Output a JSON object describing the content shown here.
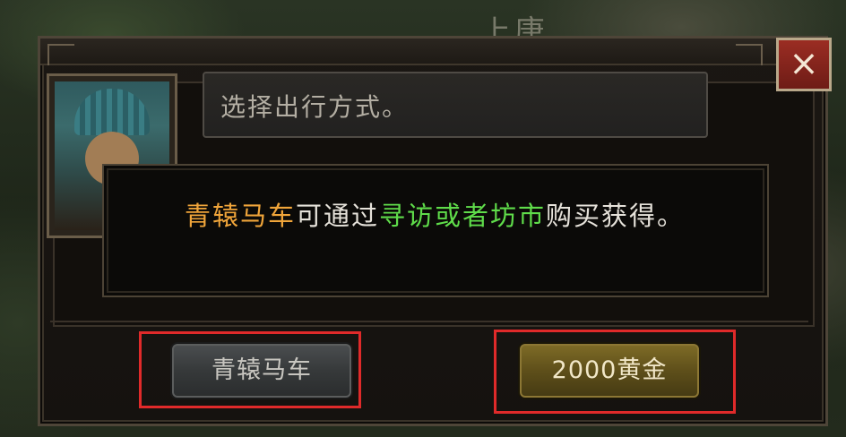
{
  "background": {
    "map_label": "上唐"
  },
  "dialog": {
    "speech": "选择出行方式。",
    "close_icon": "×"
  },
  "tip": {
    "part1": "青辕马车",
    "part2": "可通过",
    "part3": "寻访或者坊市",
    "part4": "购买获得。"
  },
  "buttons": {
    "carriage_label": "青辕马车",
    "gold_label": "2000黄金"
  },
  "colors": {
    "highlight_orange": "#f0a53a",
    "highlight_green": "#5fdc4a",
    "annotation_red": "#e02a2a"
  }
}
